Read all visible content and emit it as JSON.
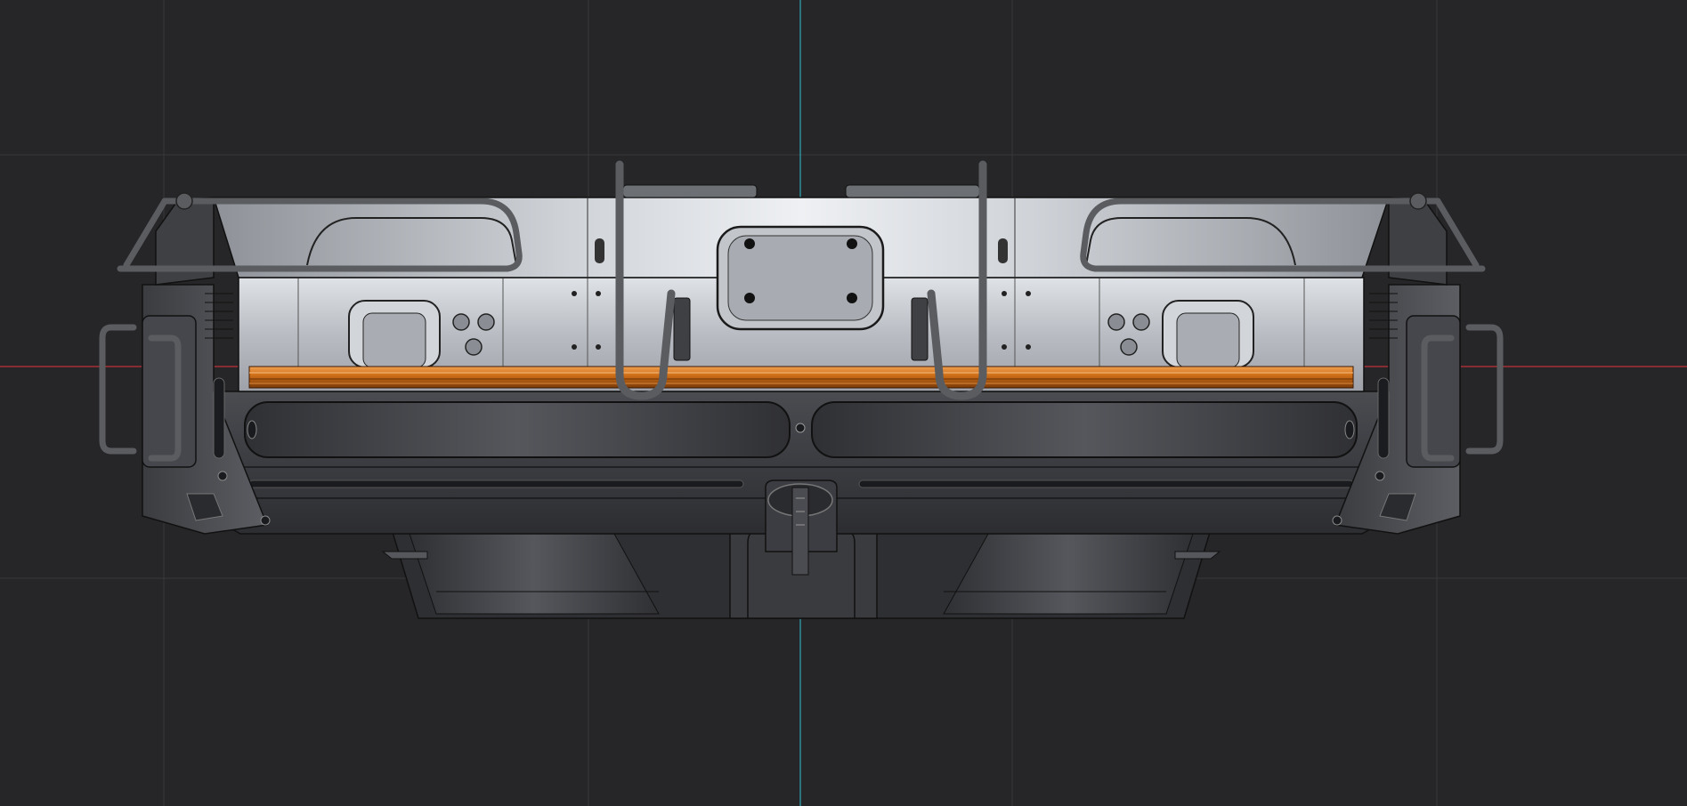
{
  "viewport": {
    "view": "front-orthographic",
    "background_color": "#262628",
    "grid_color": "#38383b",
    "x_axis_color": "#c0303a",
    "z_axis_color": "#2fa8b6",
    "grid_visible": true
  },
  "model": {
    "shading": "solid-matcap",
    "body_color": "#b8bcc2",
    "lower_body_color": "#3a3c40",
    "accent_strip_color": "#d07018",
    "rail_color": "#5a5c60"
  }
}
